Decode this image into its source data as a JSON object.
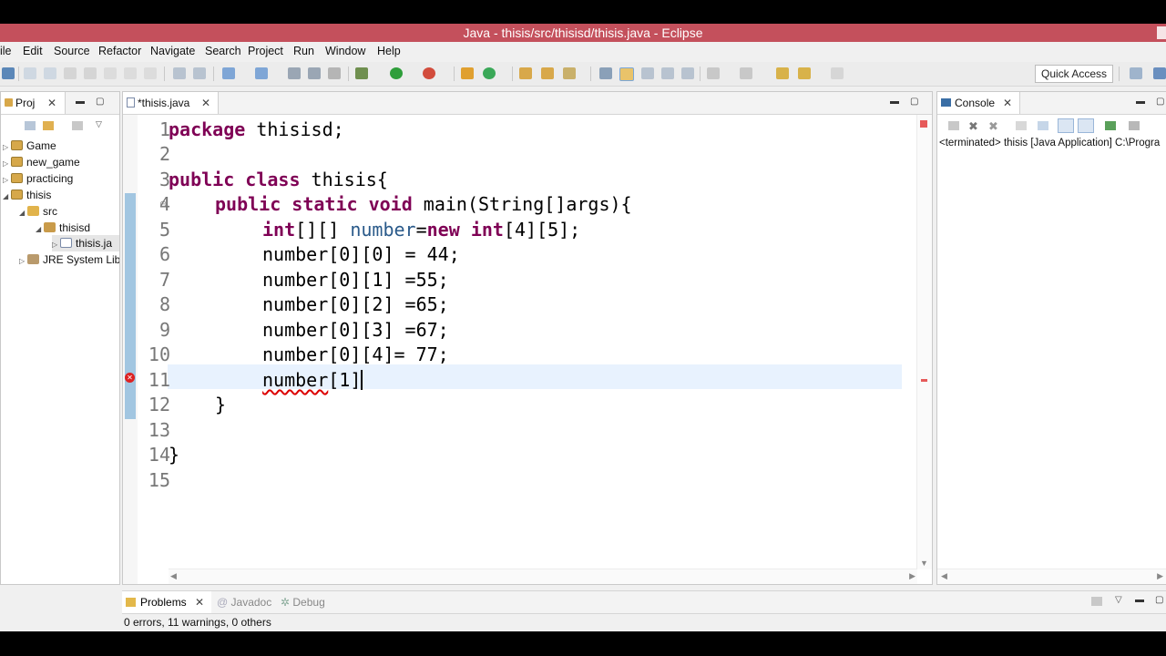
{
  "window": {
    "title": "Java - thisis/src/thisisd/thisis.java - Eclipse"
  },
  "menu": [
    "ile",
    "Edit",
    "Source",
    "Refactor",
    "Navigate",
    "Search",
    "Project",
    "Run",
    "Window",
    "Help"
  ],
  "toolbar": {
    "quick_access": "Quick Access"
  },
  "project_explorer": {
    "tab_label": "Proj",
    "items": [
      {
        "label": "Game"
      },
      {
        "label": "new_game"
      },
      {
        "label": "practicing"
      },
      {
        "label": "thisis"
      },
      {
        "label": "src"
      },
      {
        "label": "thisisd"
      },
      {
        "label": "thisis.ja"
      },
      {
        "label": "JRE System Lib"
      }
    ]
  },
  "editor": {
    "tab_label": "*thisis.java",
    "line_numbers": [
      "1",
      "2",
      "3",
      "4",
      "5",
      "6",
      "7",
      "8",
      "9",
      "10",
      "11",
      "12",
      "13",
      "14",
      "15"
    ],
    "lines": {
      "l1": {
        "kw": "package",
        "rest": " thisisd;"
      },
      "l3": {
        "kw1": "public",
        "kw2": "class",
        "rest": " thisis{"
      },
      "l4": {
        "kw1": "public",
        "kw2": "static",
        "kw3": "void",
        "rest": " main(String[]args){"
      },
      "l5": {
        "kw1": "int",
        "mid1": "[][] ",
        "var": "number",
        "mid2": "=",
        "kw2": "new",
        "kw3": "int",
        "rest": "[4][5];"
      },
      "l6": {
        "text": "number[0][0] = 44;"
      },
      "l7": {
        "text": "number[0][1] =55;"
      },
      "l8": {
        "text": "number[0][2] =65;"
      },
      "l9": {
        "text": "number[0][3] =67;"
      },
      "l10": {
        "text": "number[0][4]= 77;"
      },
      "l11": {
        "squiggle": "number",
        "bracket": "[1",
        "after": "]"
      },
      "l12": {
        "text": "}"
      },
      "l14": {
        "text": "}"
      }
    }
  },
  "console": {
    "tab_label": "Console",
    "status": "<terminated> thisis [Java Application] C:\\Progra"
  },
  "bottom": {
    "tabs": {
      "problems": "Problems",
      "javadoc": "Javadoc",
      "debug": "Debug"
    },
    "status": "0 errors, 11 warnings, 0 others"
  },
  "colors": {
    "title_bar": "#c4505c",
    "keyword": "#7f0055",
    "current_line": "#e8f2fe",
    "error": "#dd2222"
  }
}
